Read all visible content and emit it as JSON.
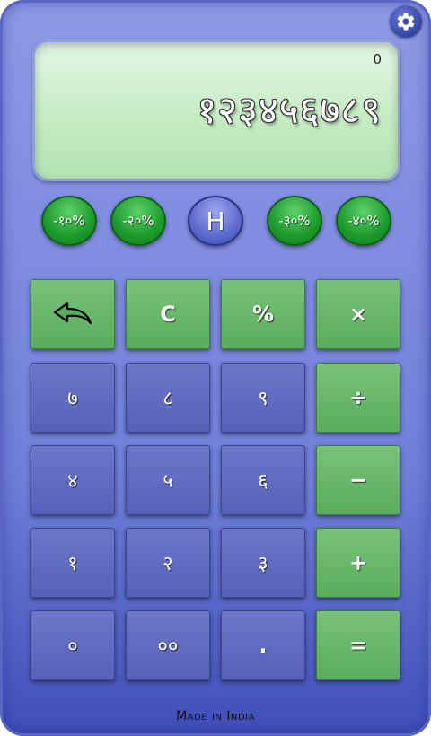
{
  "display": {
    "memory_indicator": "0",
    "value": "१२३४५६७८९"
  },
  "percent_buttons": [
    {
      "label": "-१०%"
    },
    {
      "label": "-२०%"
    },
    {
      "label": "H"
    },
    {
      "label": "-३०%"
    },
    {
      "label": "-४०%"
    }
  ],
  "keys": {
    "backspace_icon": "undo-arrow-icon",
    "clear": "C",
    "percent": "%",
    "multiply": "×",
    "seven": "७",
    "eight": "८",
    "nine": "९",
    "divide": "÷",
    "four": "४",
    "five": "५",
    "six": "६",
    "minus": "−",
    "one": "१",
    "two": "२",
    "three": "३",
    "plus": "+",
    "zero": "०",
    "double_zero": "००",
    "decimal": ".",
    "equals": "="
  },
  "footer": {
    "text": "Made in India"
  },
  "colors": {
    "body": "#7f8ce0",
    "display": "#c6ecc4",
    "green_key": "#5aad5c",
    "blue_key": "#5662b8"
  },
  "icons": {
    "settings": "gear-icon",
    "backspace": "undo-arrow-icon"
  }
}
